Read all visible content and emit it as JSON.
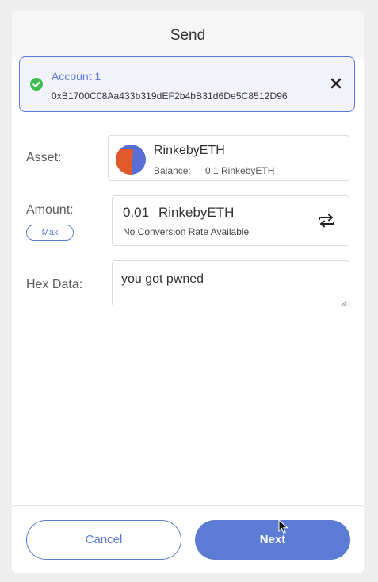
{
  "header": {
    "title": "Send"
  },
  "account": {
    "name": "Account 1",
    "address": "0xB1700C08Aa433b319dEF2b4bB31d6De5C8512D96",
    "status_icon": "check-circle-icon",
    "close_icon": "close-icon"
  },
  "form": {
    "asset_label": "Asset:",
    "amount_label": "Amount:",
    "hex_label": "Hex Data:",
    "max_label": "Max"
  },
  "asset": {
    "name": "RinkebyETH",
    "balance_label": "Balance:",
    "balance_value": "0.1 RinkebyETH"
  },
  "amount": {
    "value": "0.01",
    "unit": "RinkebyETH",
    "conversion": "No Conversion Rate Available",
    "swap_icon": "swap-icon"
  },
  "hex_data": {
    "value": "you got pwned"
  },
  "footer": {
    "cancel_label": "Cancel",
    "next_label": "Next"
  },
  "colors": {
    "accent": "#5b7bd5",
    "success": "#3dbc52",
    "asset_avatar_primary": "#e0592a",
    "asset_avatar_secondary": "#5a6fd6"
  }
}
